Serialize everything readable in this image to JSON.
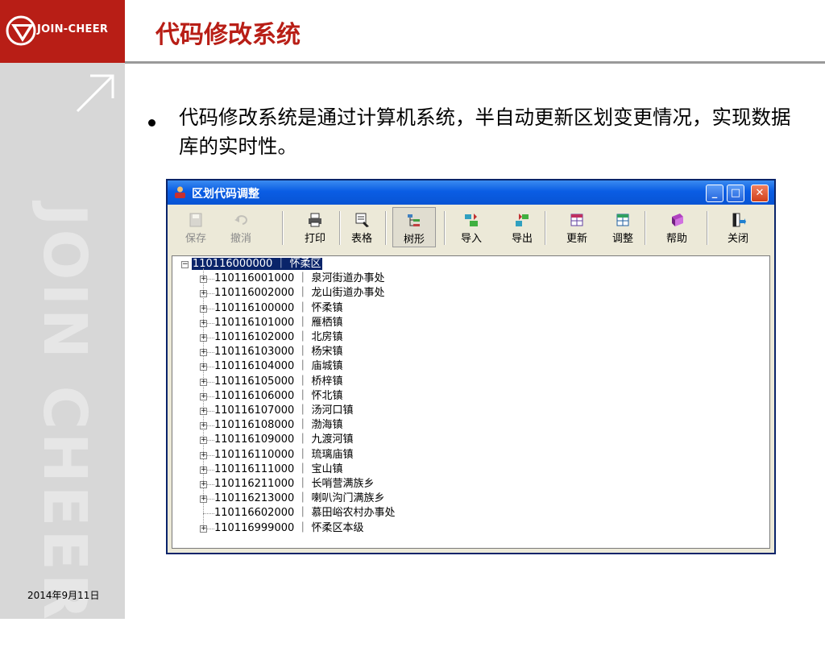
{
  "brand": {
    "logo_text": "JOIN-CHEER",
    "watermark": "JOIN CHEER"
  },
  "slide": {
    "title": "代码修改系统",
    "bullet": "代码修改系统是通过计算机系统，半自动更新区划变更情况，实现数据库的实时性。",
    "date": "2014年9月11日"
  },
  "window": {
    "title": "区划代码调整",
    "toolbar": [
      {
        "label": "保存",
        "icon": "save-icon",
        "enabled": false
      },
      {
        "label": "撤消",
        "icon": "undo-icon",
        "enabled": false
      },
      {
        "label": "打印",
        "icon": "print-icon",
        "enabled": true
      },
      {
        "label": "表格",
        "icon": "table-icon",
        "enabled": true
      },
      {
        "label": "树形",
        "icon": "tree-icon",
        "enabled": true,
        "active": true
      },
      {
        "label": "导入",
        "icon": "import-icon",
        "enabled": true
      },
      {
        "label": "导出",
        "icon": "export-icon",
        "enabled": true
      },
      {
        "label": "更新",
        "icon": "refresh-grid-icon",
        "enabled": true
      },
      {
        "label": "调整",
        "icon": "adjust-grid-icon",
        "enabled": true
      },
      {
        "label": "帮助",
        "icon": "help-book-icon",
        "enabled": true
      },
      {
        "label": "关闭",
        "icon": "exit-door-icon",
        "enabled": true
      }
    ],
    "tree": {
      "root": "110116000000 ｜ 怀柔区",
      "children": [
        {
          "label": "110116001000 ｜ 泉河街道办事处",
          "expandable": true
        },
        {
          "label": "110116002000 ｜ 龙山街道办事处",
          "expandable": true
        },
        {
          "label": "110116100000 ｜ 怀柔镇",
          "expandable": true
        },
        {
          "label": "110116101000 ｜ 雁栖镇",
          "expandable": true
        },
        {
          "label": "110116102000 ｜ 北房镇",
          "expandable": true
        },
        {
          "label": "110116103000 ｜ 杨宋镇",
          "expandable": true
        },
        {
          "label": "110116104000 ｜ 庙城镇",
          "expandable": true
        },
        {
          "label": "110116105000 ｜ 桥梓镇",
          "expandable": true
        },
        {
          "label": "110116106000 ｜ 怀北镇",
          "expandable": true
        },
        {
          "label": "110116107000 ｜ 汤河口镇",
          "expandable": true
        },
        {
          "label": "110116108000 ｜ 渤海镇",
          "expandable": true
        },
        {
          "label": "110116109000 ｜ 九渡河镇",
          "expandable": true
        },
        {
          "label": "110116110000 ｜ 琉璃庙镇",
          "expandable": true
        },
        {
          "label": "110116111000 ｜ 宝山镇",
          "expandable": true
        },
        {
          "label": "110116211000 ｜ 长哨营满族乡",
          "expandable": true
        },
        {
          "label": "110116213000 ｜ 喇叭沟门满族乡",
          "expandable": true
        },
        {
          "label": "110116602000 ｜ 慕田峪农村办事处",
          "expandable": false
        },
        {
          "label": "110116999000 ｜ 怀柔区本级",
          "expandable": true
        }
      ]
    }
  },
  "colors": {
    "brand_red": "#b81e16",
    "selection": "#0a246a",
    "window_face": "#ece9d8"
  }
}
